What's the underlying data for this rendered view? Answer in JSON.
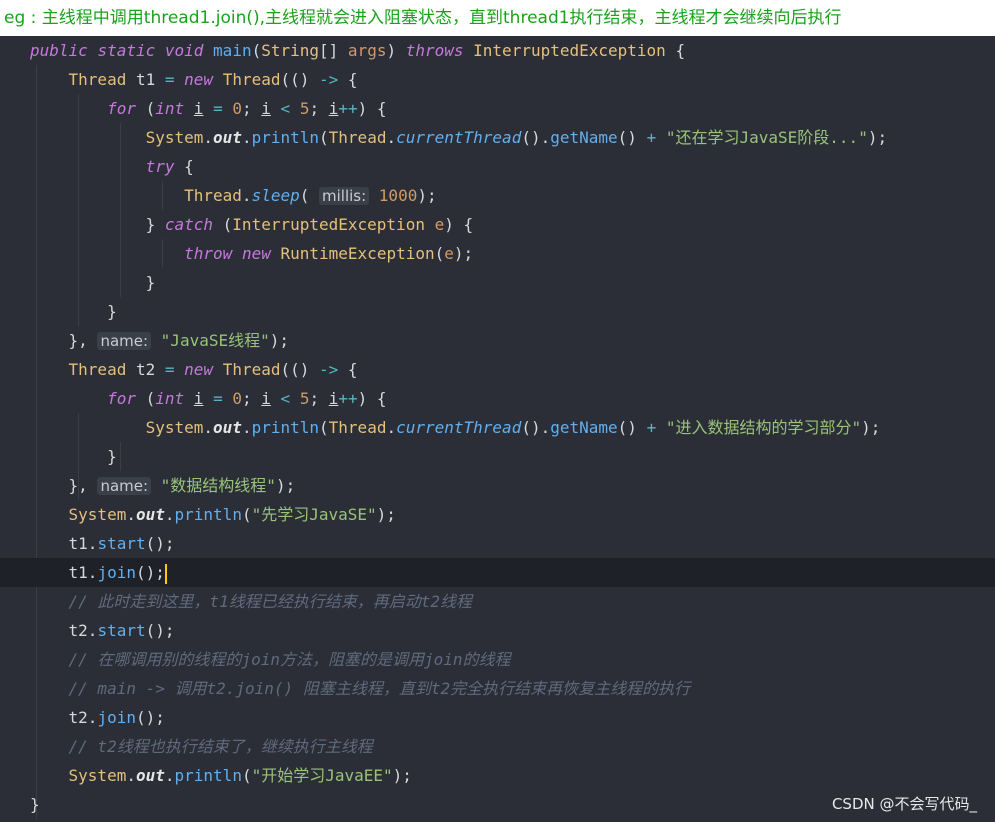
{
  "caption": "eg : 主线程中调用thread1.join(),主线程就会进入阻塞状态，直到thread1执行结束，主线程才会继续向后执行",
  "watermark": "CSDN @不会写代码_",
  "code_lines": [
    "public static void main(String[] args) throws InterruptedException {",
    "    Thread t1 = new Thread(() -> {",
    "        for (int i = 0; i < 5; i++) {",
    "            System.out.println(Thread.currentThread().getName() + \"还在学习JavaSE阶段...\");",
    "            try {",
    "                Thread.sleep( millis: 1000);",
    "            } catch (InterruptedException e) {",
    "                throw new RuntimeException(e);",
    "            }",
    "        }",
    "    }, name: \"JavaSE线程\");",
    "    Thread t2 = new Thread(() -> {",
    "        for (int i = 0; i < 5; i++) {",
    "            System.out.println(Thread.currentThread().getName() + \"进入数据结构的学习部分\");",
    "        }",
    "    }, name: \"数据结构线程\");",
    "    System.out.println(\"先学习JavaSE\");",
    "    t1.start();",
    "    t1.join();",
    "    // 此时走到这里，t1线程已经执行结束，再启动t2线程",
    "    t2.start();",
    "    // 在哪调用别的线程的join方法，阻塞的是调用join的线程",
    "    // main -> 调用t2.join() 阻塞主线程，直到t2完全执行结束再恢复主线程的执行",
    "    t2.join();",
    "    // t2线程也执行结束了，继续执行主线程",
    "    System.out.println(\"开始学习JavaEE\");",
    "}"
  ]
}
